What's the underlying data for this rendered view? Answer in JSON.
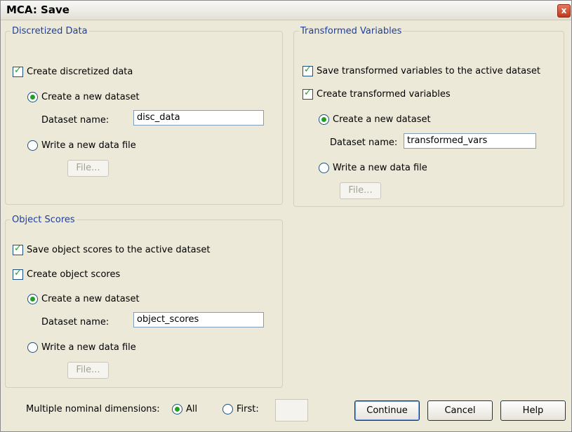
{
  "window": {
    "title": "MCA: Save",
    "close_glyph": "x"
  },
  "discretized": {
    "legend": "Discretized Data",
    "create_label": "Create discretized data",
    "create_checked": true,
    "new_dataset_label": "Create a new dataset",
    "dataset_name_label": "Dataset name:",
    "dataset_name_value": "disc_data",
    "write_file_label": "Write a new data file",
    "file_button": "File..."
  },
  "transformed": {
    "legend": "Transformed Variables",
    "save_active_label": "Save transformed variables to the active dataset",
    "create_label": "Create transformed variables",
    "new_dataset_label": "Create a new dataset",
    "dataset_name_label": "Dataset name:",
    "dataset_name_value": "transformed_vars",
    "write_file_label": "Write a new data file",
    "file_button": "File..."
  },
  "object_scores": {
    "legend": "Object Scores",
    "save_active_label": "Save object scores to the active dataset",
    "create_label": "Create object scores",
    "new_dataset_label": "Create a new dataset",
    "dataset_name_label": "Dataset name:",
    "dataset_name_value": "object_scores",
    "write_file_label": "Write a new data file",
    "file_button": "File..."
  },
  "footer": {
    "dims_label": "Multiple nominal dimensions:",
    "all_label": "All",
    "first_label": "First:",
    "first_value": "",
    "continue_button": "Continue",
    "cancel_button": "Cancel",
    "help_button": "Help"
  },
  "colors": {
    "accent": "#21a121",
    "legend_text": "#1f3f9a",
    "dialog_bg": "#ECE9D8"
  }
}
